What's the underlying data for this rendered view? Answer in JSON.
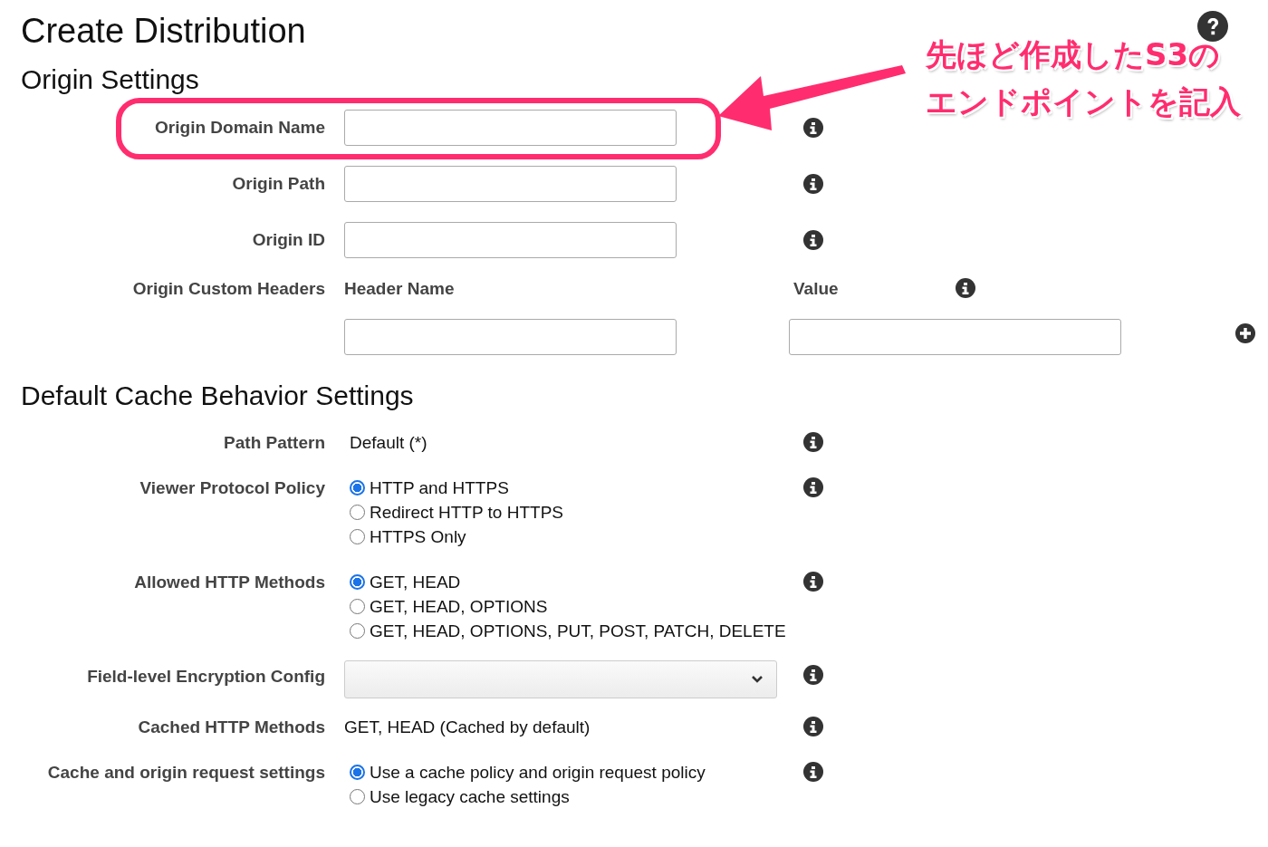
{
  "page": {
    "title": "Create Distribution"
  },
  "origin_settings": {
    "heading": "Origin Settings",
    "fields": [
      {
        "label": "Origin Domain Name",
        "highlighted": true
      },
      {
        "label": "Origin Path",
        "highlighted": false
      },
      {
        "label": "Origin ID",
        "highlighted": false
      }
    ],
    "custom_headers": {
      "label": "Origin Custom Headers",
      "columns": [
        "Header Name",
        "Value"
      ]
    }
  },
  "cache_settings": {
    "heading": "Default Cache Behavior Settings",
    "rows": [
      {
        "kind": "text",
        "label": "Path Pattern",
        "value": "Default (*)"
      },
      {
        "kind": "radio",
        "label": "Viewer Protocol Policy",
        "options": [
          {
            "label": "HTTP and HTTPS",
            "selected": true
          },
          {
            "label": "Redirect HTTP to HTTPS",
            "selected": false
          },
          {
            "label": "HTTPS Only",
            "selected": false
          }
        ]
      },
      {
        "kind": "radio",
        "label": "Allowed HTTP Methods",
        "options": [
          {
            "label": "GET, HEAD",
            "selected": true
          },
          {
            "label": "GET, HEAD, OPTIONS",
            "selected": false
          },
          {
            "label": "GET, HEAD, OPTIONS, PUT, POST, PATCH, DELETE",
            "selected": false
          }
        ]
      },
      {
        "kind": "select",
        "label": "Field-level Encryption Config"
      },
      {
        "kind": "text",
        "label": "Cached HTTP Methods",
        "value": "GET, HEAD (Cached by default)"
      },
      {
        "kind": "radio",
        "label": "Cache and origin request settings",
        "options": [
          {
            "label": "Use a cache policy and origin request policy",
            "selected": true
          },
          {
            "label": "Use legacy cache settings",
            "selected": false
          }
        ]
      }
    ]
  },
  "annotation": {
    "lines": [
      "先ほど作成したS3の",
      "エンドポイントを記入"
    ]
  }
}
